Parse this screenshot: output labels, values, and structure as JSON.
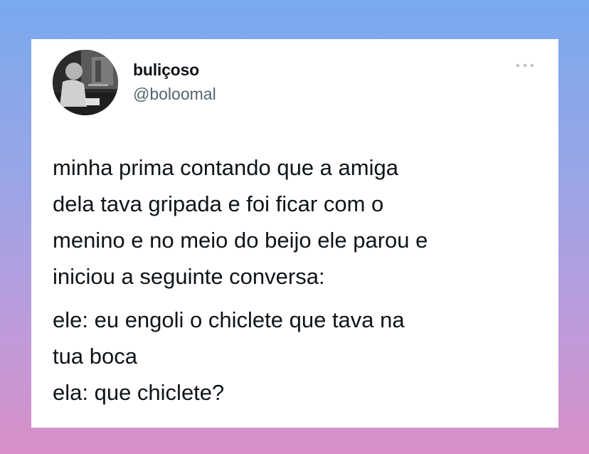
{
  "tweet": {
    "author": {
      "display_name": "buliçoso",
      "handle": "@boloomal",
      "avatar_icon": "avatar-photo"
    },
    "more_icon": "more-horizontal-icon",
    "paragraphs": [
      {
        "lines": [
          "minha prima contando que a amiga",
          "dela tava gripada e foi ficar com o",
          "menino e no meio do beijo ele parou e",
          "iniciou a seguinte conversa:"
        ]
      },
      {
        "lines": [
          "ele: eu engoli o chiclete que tava na",
          "tua boca",
          "ela: que chiclete?"
        ]
      }
    ]
  },
  "colors": {
    "background_top": "#79a9ee",
    "background_bottom": "#d88fc8",
    "card": "#ffffff",
    "text_primary": "#0f1419",
    "text_secondary": "#536471"
  }
}
